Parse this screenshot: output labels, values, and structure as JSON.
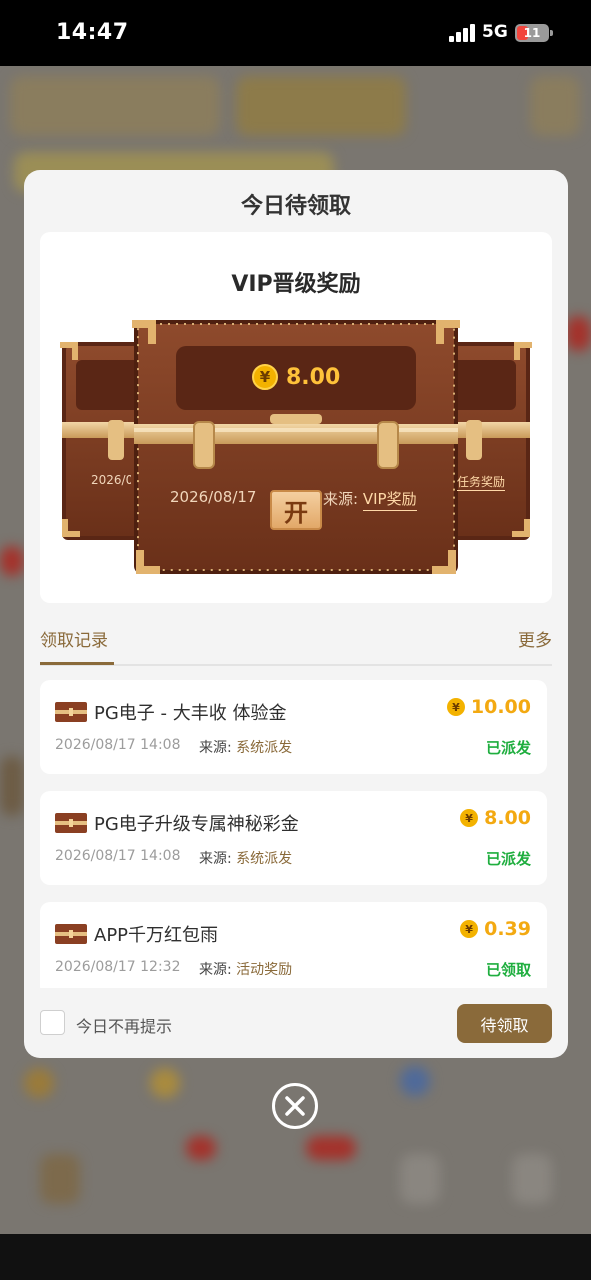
{
  "status_bar": {
    "time": "14:47",
    "network": "5G",
    "battery": "11"
  },
  "modal": {
    "title": "今日待领取",
    "chest": {
      "title": "VIP晋级奖励",
      "amount": "8.00",
      "currency_symbol": "¥",
      "open_label": "开",
      "date": "2026/08/17",
      "source_label": "来源:",
      "source_value": "VIP奖励",
      "left_chest_date": "2026/08/17",
      "right_chest_source": "任务奖励"
    },
    "tabs": {
      "records": "领取记录",
      "more": "更多"
    },
    "records": [
      {
        "title": "PG电子 - 大丰收 体验金",
        "amount": "10.00",
        "time": "2026/08/17 14:08",
        "source_label": "来源:",
        "source_value": "系统派发",
        "status": "已派发"
      },
      {
        "title": "PG电子升级专属神秘彩金",
        "amount": "8.00",
        "time": "2026/08/17 14:08",
        "source_label": "来源:",
        "source_value": "系统派发",
        "status": "已派发"
      },
      {
        "title": "APP千万红包雨",
        "amount": "0.39",
        "time": "2026/08/17 12:32",
        "source_label": "来源:",
        "source_value": "活动奖励",
        "status": "已领取"
      }
    ],
    "footer": {
      "dont_remind_label": "今日不再提示",
      "claim_button": "待领取"
    }
  },
  "colors": {
    "brown_accent": "#8a6a3a",
    "gold": "#f3a911",
    "status_green": "#1fae3f",
    "chest_leather": "#7a3a22"
  },
  "icons": {
    "close": "close-circle-icon",
    "coin": "yuan-coin-icon",
    "record": "treasure-chest-icon"
  }
}
